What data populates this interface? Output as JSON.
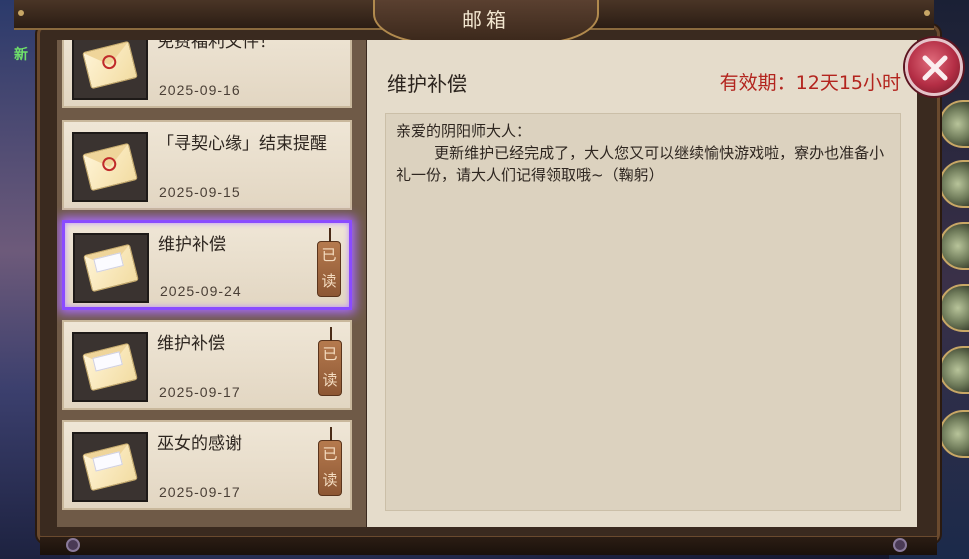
{
  "window": {
    "title": "邮箱"
  },
  "background": {
    "new_label": "新"
  },
  "mail_list": [
    {
      "title": "免费福利文件！",
      "date": "2025-09-16",
      "read_label": "",
      "icon": "sealed-envelope-icon",
      "selected": false
    },
    {
      "title": "「寻契心缘」结束提醒",
      "date": "2025-09-15",
      "read_label": "",
      "icon": "sealed-envelope-icon",
      "selected": false
    },
    {
      "title": "维护补偿",
      "date": "2025-09-24",
      "read_label": "已读",
      "icon": "open-envelope-icon",
      "selected": true
    },
    {
      "title": "维护补偿",
      "date": "2025-09-17",
      "read_label": "已读",
      "icon": "open-envelope-icon",
      "selected": false
    },
    {
      "title": "巫女的感谢",
      "date": "2025-09-17",
      "read_label": "已读",
      "icon": "open-envelope-icon",
      "selected": false
    }
  ],
  "detail": {
    "title": "维护补偿",
    "expiry": "有效期：12天15小时",
    "body": "亲爱的阴阳师大人：\n        更新维护已经完成了，大人您又可以继续愉快游戏啦，寮办也准备小礼一份，请大人们记得领取哦~（鞠躬）"
  },
  "colors": {
    "accent": "#8a4bff",
    "expiry": "#b3241e",
    "close": "#b42e45"
  }
}
